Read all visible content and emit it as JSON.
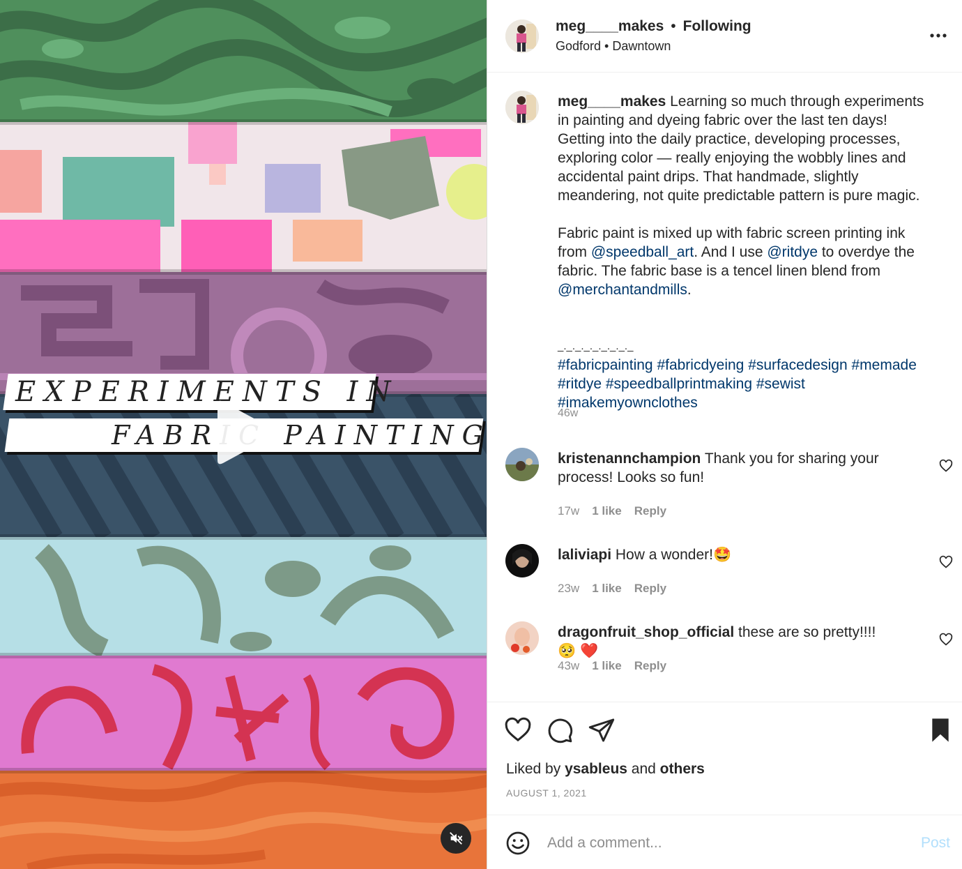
{
  "media": {
    "overlay_line1": "EXPERIMENTS IN",
    "overlay_line2": "FABRIC PAINTING"
  },
  "header": {
    "username": "meg____makes",
    "separator": "•",
    "follow_status": "Following",
    "location": "Godford • Dawntown"
  },
  "caption": {
    "username": "meg____makes",
    "text1": " Learning so much through experiments in painting and dyeing fabric over the last ten days! Getting into the daily practice, developing processes, exploring color — really enjoying the wobbly lines and accidental paint drips. That handmade, slightly meandering, not quite predictable pattern is pure magic.",
    "text2a": "Fabric paint is mixed up with fabric screen printing ink from ",
    "mention1": "@speedball_art",
    "text2b": ". And I use ",
    "mention2": "@ritdye",
    "text2c": " to overdye the fabric. The fabric base is a tencel linen blend from ",
    "mention3": "@merchantandmills",
    "text2d": ".",
    "divider": "_._._._._._._._._",
    "hashtags": [
      "#fabricpainting",
      "#fabricdyeing",
      "#surfacedesign",
      "#memade",
      "#ritdye",
      "#speedballprintmaking",
      "#sewist",
      "#imakemyownclothes"
    ],
    "time": "46w"
  },
  "comments": [
    {
      "username": "kristenannchampion",
      "text": "Thank you for sharing your process! Looks so fun!",
      "time": "17w",
      "likes": "1 like",
      "reply": "Reply"
    },
    {
      "username": "laliviapi",
      "text": "How a wonder!🤩",
      "time": "23w",
      "likes": "1 like",
      "reply": "Reply"
    },
    {
      "username": "dragonfruit_shop_official",
      "text": "these are so pretty!!!! 🥺 ❤️",
      "time": "43w",
      "likes": "1 like",
      "reply": "Reply"
    }
  ],
  "footer": {
    "liked_by_prefix": "Liked by ",
    "liked_by_user": "ysableus",
    "liked_by_mid": " and ",
    "liked_by_others": "others",
    "date": "AUGUST 1, 2021",
    "comment_placeholder": "Add a comment...",
    "post_label": "Post"
  },
  "icons": {
    "like": "heart-icon",
    "comment": "comment-icon",
    "share": "share-icon",
    "save": "bookmark-icon",
    "more": "more-icon",
    "emoji": "emoji-icon",
    "play": "play-icon",
    "mute": "mute-icon"
  },
  "colors": {
    "link": "#00376b",
    "muted": "#8e8e8e",
    "post_disabled": "#b2dffc"
  }
}
